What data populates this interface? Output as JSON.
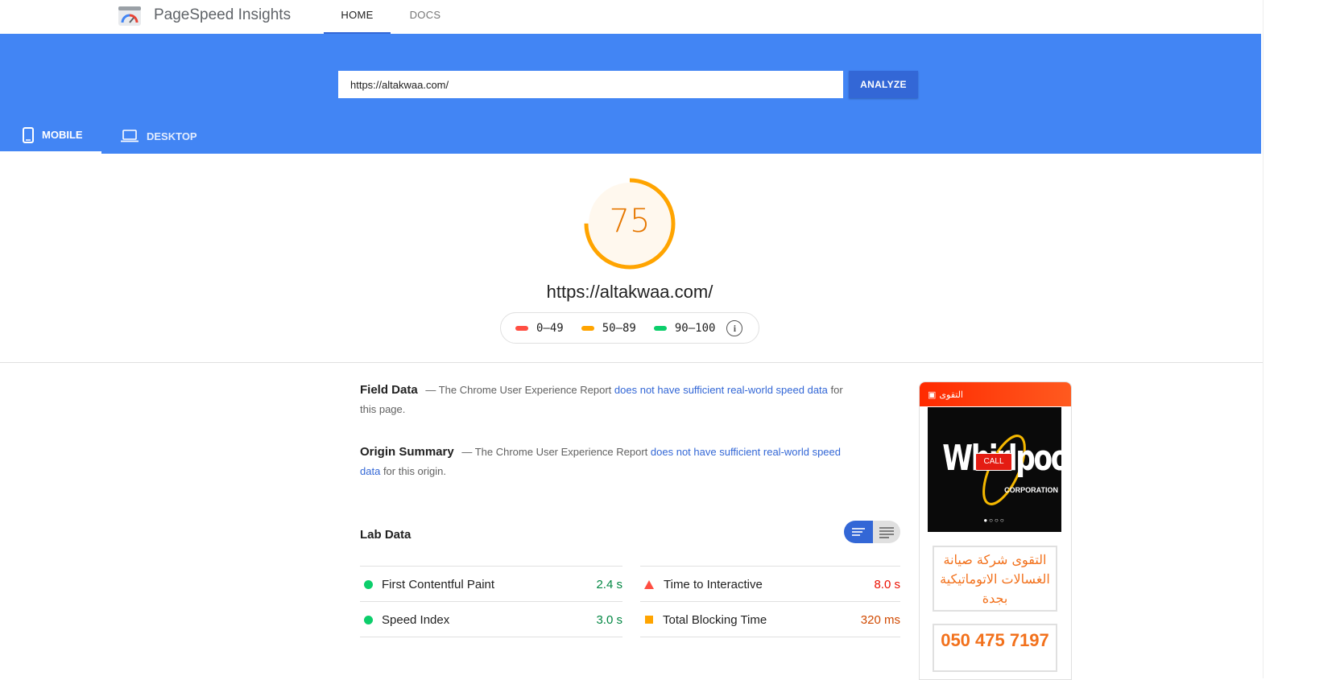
{
  "header": {
    "brand": "PageSpeed Insights",
    "nav": [
      {
        "label": "HOME",
        "active": true
      },
      {
        "label": "DOCS",
        "active": false
      }
    ]
  },
  "search": {
    "url_value": "https://altakwaa.com/",
    "analyze_label": "ANALYZE"
  },
  "device_tabs": [
    {
      "label": "MOBILE",
      "active": true,
      "icon": "smartphone-icon"
    },
    {
      "label": "DESKTOP",
      "active": false,
      "icon": "laptop-icon"
    }
  ],
  "score": {
    "value": "75",
    "fraction": 0.75,
    "color": "#ffa400",
    "url": "https://altakwaa.com/"
  },
  "legend": [
    {
      "range": "0–49",
      "color": "#ff4e42"
    },
    {
      "range": "50–89",
      "color": "#ffa400"
    },
    {
      "range": "90–100",
      "color": "#0cce6b"
    }
  ],
  "field_data": {
    "title": "Field Data",
    "text_before": "— The Chrome User Experience Report",
    "link": "does not have sufficient real-world speed data",
    "text_after": "for this page."
  },
  "origin_summary": {
    "title": "Origin Summary",
    "text_before": "— The Chrome User Experience Report",
    "link": "does not have sufficient real-world speed data",
    "text_after": "for this origin."
  },
  "lab_data": {
    "title": "Lab Data",
    "metrics": [
      {
        "name": "First Contentful Paint",
        "value": "2.4 s",
        "status": "pass",
        "color": "#0cce6b"
      },
      {
        "name": "Time to Interactive",
        "value": "8.0 s",
        "status": "fail",
        "color": "#ff4e42"
      },
      {
        "name": "Speed Index",
        "value": "3.0 s",
        "status": "pass",
        "color": "#0cce6b"
      },
      {
        "name": "Total Blocking Time",
        "value": "320 ms",
        "status": "average",
        "color": "#ffa400"
      }
    ]
  },
  "screenshot": {
    "site_title": "التقوى",
    "logo_text": "Whirlpool",
    "logo_subtext": "CORPORATION",
    "call_label": "CALL",
    "carousel_dots": "●○○○",
    "arabic_text": "التقوى شركة صيانة الغسالات الاتوماتيكية بجدة",
    "phone_number": "050 475 7197"
  },
  "colors": {
    "hero": "#4285f4",
    "accent": "#3367d6",
    "pass": "#0cce6b",
    "average": "#ffa400",
    "fail": "#ff4e42"
  }
}
